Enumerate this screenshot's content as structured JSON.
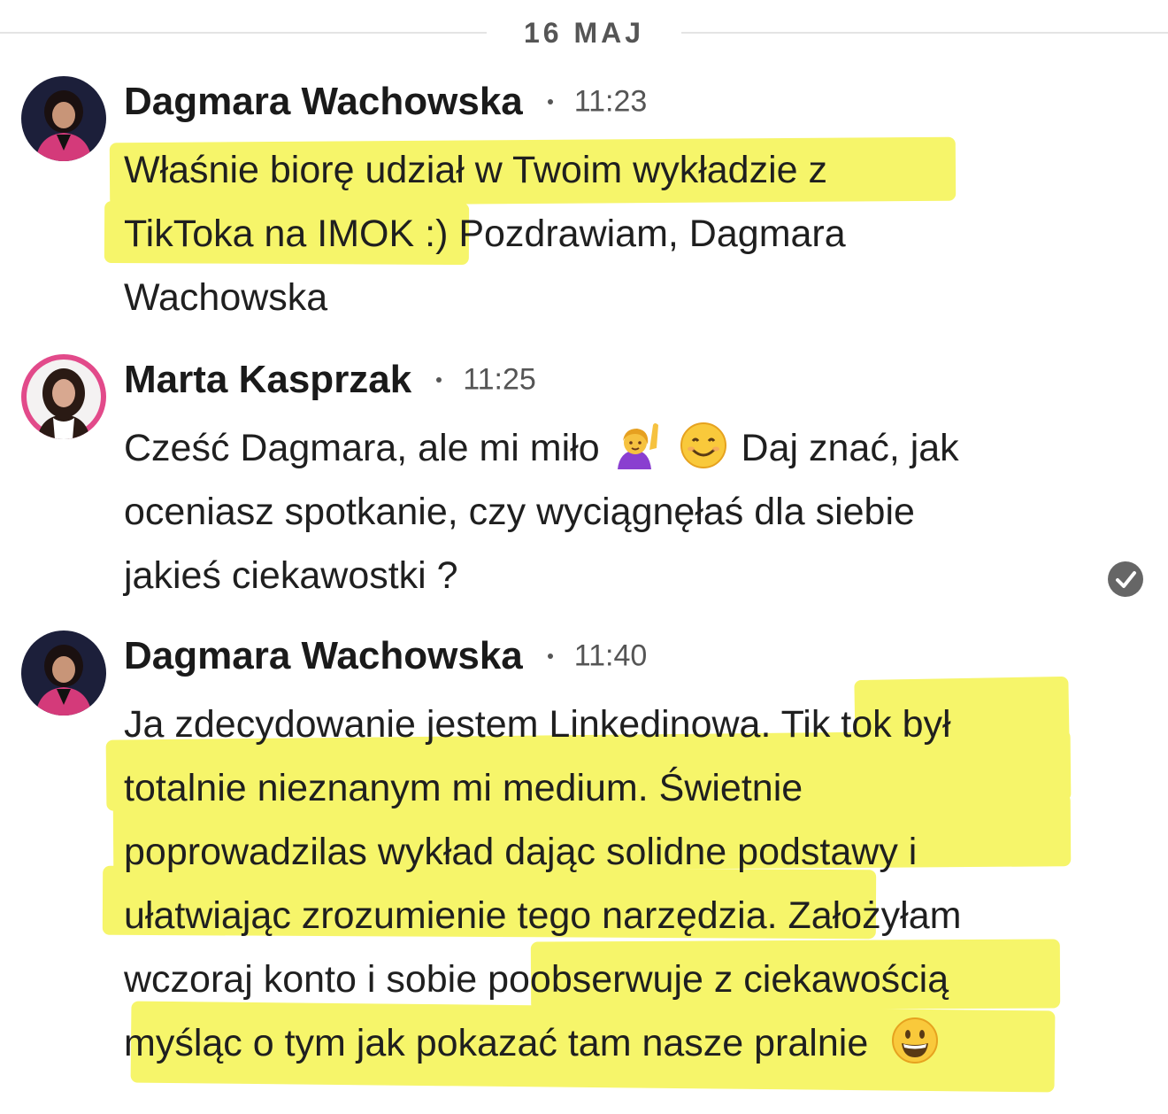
{
  "date_separator": "16 MAJ",
  "messages": [
    {
      "sender": "Dagmara Wachowska",
      "time": "11:23",
      "lines": [
        "Właśnie biorę udział w Twoim wykładzie z",
        "TikToka na IMOK :) Pozdrawiam, Dagmara",
        "Wachowska"
      ]
    },
    {
      "sender": "Marta Kasprzak",
      "time": "11:25",
      "line1_a": "Cześć Dagmara, ale mi miło",
      "line1_b": "Daj znać, jak",
      "lines": [
        "oceniasz spotkanie, czy wyciągnęłaś dla siebie",
        "jakieś ciekawostki ?"
      ],
      "emojis": [
        "raising-hand-emoji",
        "smiling-face-emoji"
      ],
      "read_status": "check-icon"
    },
    {
      "sender": "Dagmara Wachowska",
      "time": "11:40",
      "lines": [
        "Ja zdecydowanie jestem Linkedinowa. Tik tok był",
        "totalnie nieznanym mi medium. Świetnie",
        "poprowadzilas wykład dając solidne podstawy i",
        "ułatwiając zrozumienie tego narzędzia. Założyłam",
        "wczoraj konto i sobie poobserwuje z ciekawością",
        "myśląc o tym jak pokazać tam nasze pralnie"
      ],
      "emoji": "grinning-face-emoji"
    }
  ],
  "colors": {
    "highlight": "#f6f56a",
    "text": "#1f1f1f",
    "meta": "#555555"
  }
}
